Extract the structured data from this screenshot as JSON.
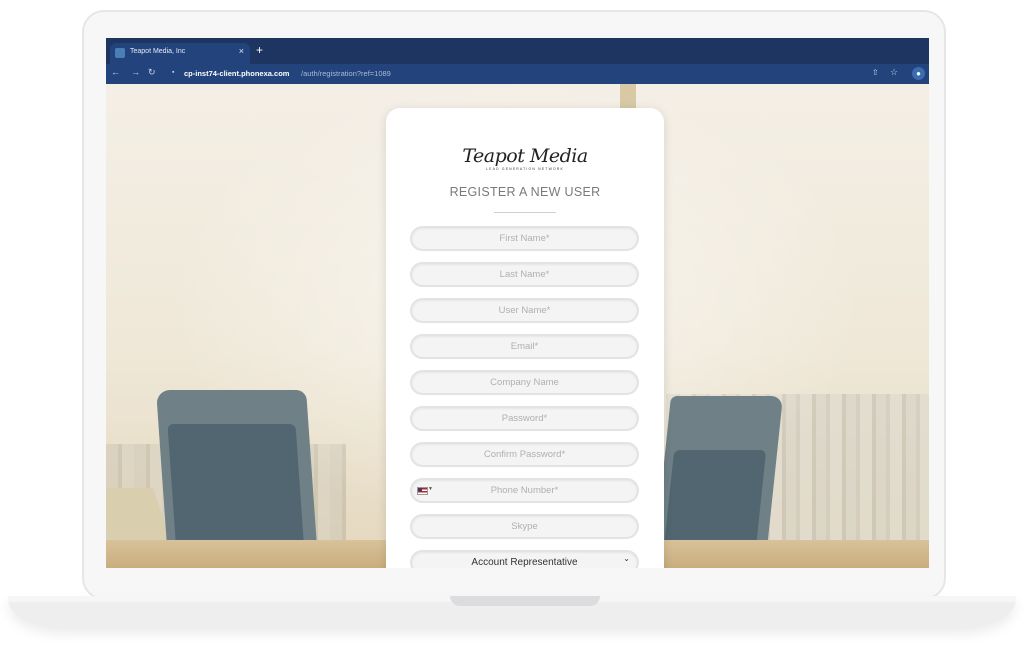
{
  "browser": {
    "tab_title": "Teapot Media, Inc",
    "tab_close": "×",
    "new_tab": "+",
    "url_host": "cp-inst74-client.phonexa.com",
    "url_path": "/auth/registration?ref=1089",
    "icons": [
      "back-icon",
      "forward-icon",
      "reload-icon",
      "lock-icon",
      "share-icon",
      "star-icon",
      "profile-icon"
    ]
  },
  "logo": {
    "script": "Teapot Media",
    "tagline": "LEAD GENERATION NETWORK"
  },
  "form": {
    "heading": "REGISTER A NEW USER",
    "fields": {
      "first_name": "First Name*",
      "last_name": "Last Name*",
      "user_name": "User Name*",
      "email": "Email*",
      "company": "Company Name",
      "password": "Password*",
      "confirm_password": "Confirm Password*",
      "phone": "Phone Number*",
      "skype": "Skype"
    },
    "account_rep": {
      "selected": "Account Representative"
    }
  },
  "colors": {
    "tabbar": "#1e3461",
    "navbar": "#22437c",
    "field_border": "#e3e3e3",
    "placeholder": "#b0b0b0"
  }
}
